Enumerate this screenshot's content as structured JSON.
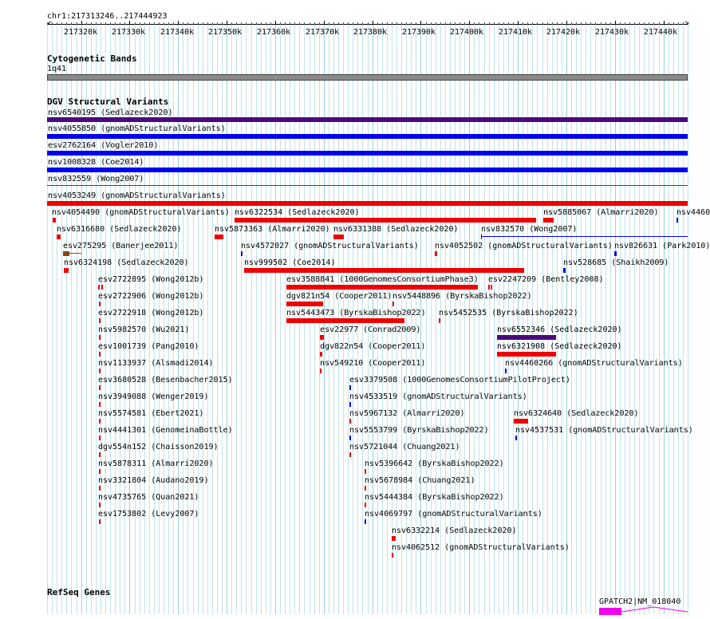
{
  "ruler": {
    "position": "chr1:217313246..217444923",
    "tick_labels": [
      "217320k",
      "217330k",
      "217340k",
      "217350k",
      "217360k",
      "217370k",
      "217380k",
      "217390k",
      "217400k",
      "217410k",
      "217420k",
      "217430k",
      "217440k"
    ]
  },
  "tracks": {
    "cytoband": {
      "title": "Cytogenetic Bands",
      "band_label": "1q41"
    },
    "dgv": {
      "title": "DGV Structural Variants"
    },
    "refseq": {
      "title": "RefSeq Genes",
      "gene_label": "GPATCH2|NM_018040"
    }
  },
  "colors": {
    "deletion": "#ee0000",
    "gain": "#0000ee",
    "complex": "#4b0a7a",
    "inversion": "#8b4513",
    "gene": "#ee00ee",
    "grid": "#bfe3ea"
  },
  "variants": [
    "nsv6540195 (Sedlazeck2020)",
    "nsv4055850 (gnomADStructuralVariants)",
    "esv2762164 (Vogler2010)",
    "nsv1008328 (Coe2014)",
    "nsv832559 (Wong2007)",
    "nsv4053249 (gnomADStructuralVariants)",
    "nsv4054490 (gnomADStructuralVariants)",
    "nsv6322534 (Sedlazeck2020)",
    "nsv5885067 (Almarri2020)",
    "nsv4460",
    "nsv6316680 (Sedlazeck2020)",
    "nsv5873363 (Almarri2020)",
    "nsv6331388 (Sedlazeck2020)",
    "nsv832570 (Wong2007)",
    "esv275295 (Banerjee2011)",
    "nsv4572027 (gnomADStructuralVariants)",
    "nsv4052502 (gnomADStructuralVariants)",
    "nsv826631 (Park2010)",
    "nsv6324198 (Sedlazeck2020)",
    "nsv999502 (Coe2014)",
    "nsv528685 (Shaikh2009)",
    "esv2722895 (Wong2012b)",
    "esv3588841 (1000GenomesConsortiumPhase3)",
    "esv2247209 (Bentley2008)",
    "esv2722906 (Wong2012b)",
    "dgv821n54 (Cooper2011)",
    "nsv5448896 (ByrskaBishop2022)",
    "esv2722918 (Wong2012b)",
    "nsv5443473 (ByrskaBishop2022)",
    "nsv5452535 (ByrskaBishop2022)",
    "nsv5982570 (Wu2021)",
    "esv22977 (Conrad2009)",
    "nsv6552346 (Sedlazeck2020)",
    "esv1001739 (Pang2010)",
    "dgv822n54 (Cooper2011)",
    "nsv6321908 (Sedlazeck2020)",
    "nsv1133937 (Alsmadi2014)",
    "nsv549210 (Cooper2011)",
    "nsv4460266 (gnomADStructuralVariants)",
    "esv3680528 (Besenbacher2015)",
    "esv3379508 (1000GenomesConsortiumPilotProject)",
    "nsv3949088 (Wenger2019)",
    "nsv4533519 (gnomADStructuralVariants)",
    "nsv5574581 (Ebert2021)",
    "nsv5967132 (Almarri2020)",
    "nsv6324640 (Sedlazeck2020)",
    "nsv4441301 (GenomeinaBottle)",
    "nsv5553799 (ByrskaBishop2022)",
    "nsv4537531 (gnomADStructuralVariants)",
    "dgv554n152 (Chaisson2019)",
    "nsv5721044 (Chuang2021)",
    "nsv5878311 (Almarri2020)",
    "nsv5396642 (ByrskaBishop2022)",
    "nsv3321804 (Audano2019)",
    "nsv5678984 (Chuang2021)",
    "nsv4735765 (Quan2021)",
    "nsv5444384 (ByrskaBishop2022)",
    "esv1753802 (Levy2007)",
    "nsv4069797 (gnomADStructuralVariants)",
    "nsv6332214 (Sedlazeck2020)",
    "nsv4062512 (gnomADStructuralVariants)"
  ]
}
